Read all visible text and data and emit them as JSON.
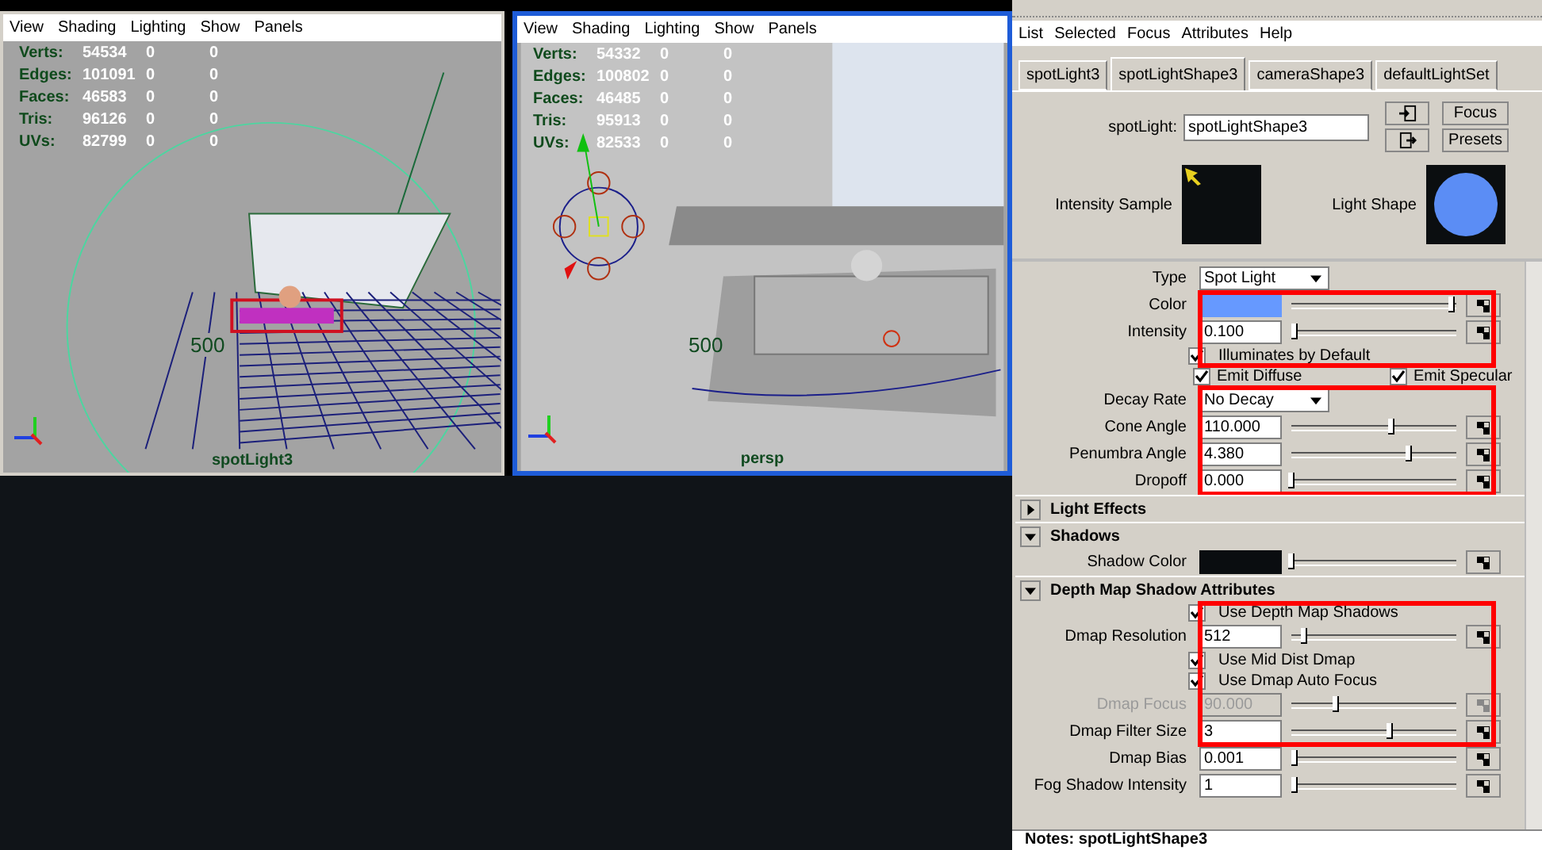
{
  "viewports": [
    {
      "selected": false,
      "kind": "wireframe",
      "menu": [
        "View",
        "Shading",
        "Lighting",
        "Show",
        "Panels"
      ],
      "stats": [
        {
          "label": "Verts:",
          "values": [
            "54534",
            "0",
            "0"
          ]
        },
        {
          "label": "Edges:",
          "values": [
            "101091",
            "0",
            "0"
          ]
        },
        {
          "label": "Faces:",
          "values": [
            "46583",
            "0",
            "0"
          ]
        },
        {
          "label": "Tris:",
          "values": [
            "96126",
            "0",
            "0"
          ]
        },
        {
          "label": "UVs:",
          "values": [
            "82799",
            "0",
            "0"
          ]
        }
      ],
      "distance_label": "500",
      "camera": "spotLight3"
    },
    {
      "selected": true,
      "kind": "shaded",
      "menu": [
        "View",
        "Shading",
        "Lighting",
        "Show",
        "Panels"
      ],
      "stats": [
        {
          "label": "Verts:",
          "values": [
            "54332",
            "0",
            "0"
          ]
        },
        {
          "label": "Edges:",
          "values": [
            "100802",
            "0",
            "0"
          ]
        },
        {
          "label": "Faces:",
          "values": [
            "46485",
            "0",
            "0"
          ]
        },
        {
          "label": "Tris:",
          "values": [
            "95913",
            "0",
            "0"
          ]
        },
        {
          "label": "UVs:",
          "values": [
            "82533",
            "0",
            "0"
          ]
        }
      ],
      "distance_label": "500",
      "camera": "persp"
    }
  ],
  "attribute_editor": {
    "menu": [
      "List",
      "Selected",
      "Focus",
      "Attributes",
      "Help"
    ],
    "tabs": [
      {
        "label": "spotLight3",
        "selected": false
      },
      {
        "label": "spotLightShape3",
        "selected": true
      },
      {
        "label": "cameraShape3",
        "selected": false
      },
      {
        "label": "defaultLightSet",
        "selected": false
      }
    ],
    "node_label": "spotLight:",
    "node_name": "spotLightShape3",
    "buttons": [
      "Focus",
      "Presets"
    ],
    "swatches": [
      {
        "label": "Intensity Sample",
        "kind": "intensity"
      },
      {
        "label": "Light Shape",
        "kind": "shape"
      }
    ],
    "groups": [
      {
        "highlighted": false,
        "rows": [
          {
            "kind": "dropdown",
            "label": "Type",
            "value": "Spot Light"
          }
        ]
      },
      {
        "highlighted": true,
        "rows": [
          {
            "kind": "color",
            "label": "Color",
            "color": "#6699ff",
            "level": 0.97
          },
          {
            "kind": "slider",
            "label": "Intensity",
            "value": "0.100",
            "level": 0.02,
            "disabled": false
          },
          {
            "kind": "checkbox",
            "label": "Illuminates by Default",
            "checked": true
          }
        ]
      },
      {
        "highlighted": false,
        "rows": [
          {
            "kind": "checkbox_pair",
            "items": [
              {
                "label": "Emit Diffuse",
                "checked": true
              },
              {
                "label": "Emit Specular",
                "checked": true
              }
            ]
          }
        ]
      },
      {
        "highlighted": true,
        "rows": [
          {
            "kind": "dropdown",
            "label": "Decay Rate",
            "value": "No Decay"
          },
          {
            "kind": "slider",
            "label": "Cone Angle",
            "value": "110.000",
            "level": 0.61,
            "disabled": false
          },
          {
            "kind": "slider",
            "label": "Penumbra Angle",
            "value": "4.380",
            "level": 0.71,
            "disabled": false
          },
          {
            "kind": "slider",
            "label": "Dropoff",
            "value": "0.000",
            "level": 0.0,
            "disabled": false
          }
        ]
      },
      {
        "highlighted": false,
        "rows": [
          {
            "kind": "section",
            "label": "Light Effects",
            "expanded": false
          },
          {
            "kind": "section",
            "label": "Shadows",
            "expanded": true
          },
          {
            "kind": "color",
            "label": "Shadow Color",
            "color": "#0a0d10",
            "level": 0.0
          },
          {
            "kind": "section",
            "label": "Depth Map Shadow Attributes",
            "expanded": true
          }
        ]
      },
      {
        "highlighted": true,
        "rows": [
          {
            "kind": "checkbox",
            "label": "Use Depth Map Shadows",
            "checked": true
          },
          {
            "kind": "slider",
            "label": "Dmap Resolution",
            "value": "512",
            "level": 0.08,
            "disabled": false
          },
          {
            "kind": "checkbox",
            "label": "Use Mid Dist Dmap",
            "checked": true
          },
          {
            "kind": "checkbox",
            "label": "Use Dmap Auto Focus",
            "checked": true
          },
          {
            "kind": "slider",
            "label": "Dmap Focus",
            "value": "90.000",
            "level": 0.27,
            "disabled": true
          },
          {
            "kind": "slider",
            "label": "Dmap Filter Size",
            "value": "3",
            "level": 0.6,
            "disabled": false
          }
        ]
      },
      {
        "highlighted": false,
        "rows": [
          {
            "kind": "slider",
            "label": "Dmap Bias",
            "value": "0.001",
            "level": 0.02,
            "disabled": false
          },
          {
            "kind": "slider",
            "label": "Fog Shadow Intensity",
            "value": "1",
            "level": 0.02,
            "disabled": false
          }
        ]
      }
    ],
    "notes": "Notes: spotLightShape3"
  }
}
